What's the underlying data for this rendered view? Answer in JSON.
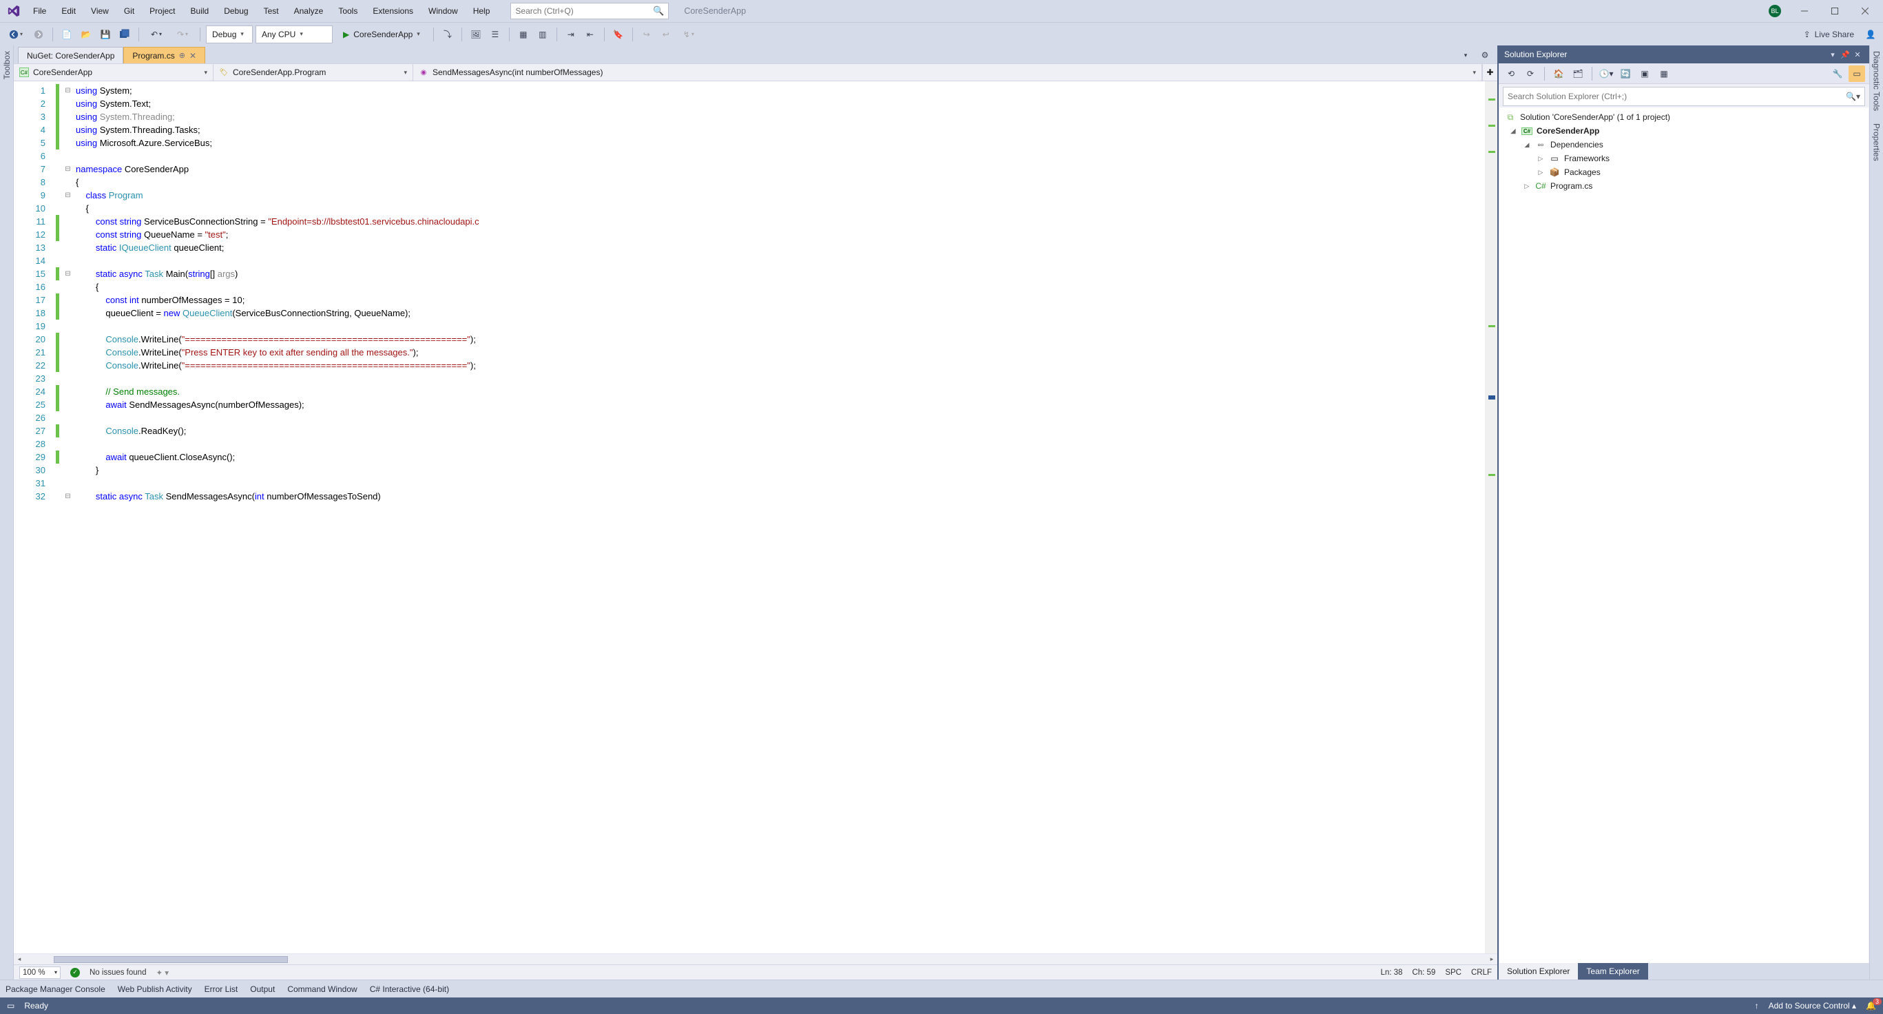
{
  "titlebar": {
    "menus": [
      "File",
      "Edit",
      "View",
      "Git",
      "Project",
      "Build",
      "Debug",
      "Test",
      "Analyze",
      "Tools",
      "Extensions",
      "Window",
      "Help"
    ],
    "searchPlaceholder": "Search (Ctrl+Q)",
    "appName": "CoreSenderApp",
    "avatar": "BL"
  },
  "toolbar": {
    "configCombo": "Debug",
    "platformCombo": "Any CPU",
    "startTarget": "CoreSenderApp",
    "liveShare": "Live Share"
  },
  "leftPanel": {
    "label": "Toolbox"
  },
  "rightPanel": {
    "labels": [
      "Diagnostic Tools",
      "Properties"
    ]
  },
  "docTabs": {
    "tabs": [
      {
        "label": "NuGet: CoreSenderApp",
        "active": false
      },
      {
        "label": "Program.cs",
        "active": true
      }
    ]
  },
  "navbar": {
    "scope": "CoreSenderApp",
    "type": "CoreSenderApp.Program",
    "member": "SendMessagesAsync(int numberOfMessages)"
  },
  "code": {
    "lines": [
      {
        "n": 1,
        "chg": true,
        "fold": "-",
        "tokens": [
          [
            "kw",
            "using"
          ],
          [
            "ident",
            " System;"
          ]
        ]
      },
      {
        "n": 2,
        "chg": true,
        "tokens": [
          [
            "kw",
            "using"
          ],
          [
            "ident",
            " System.Text;"
          ]
        ]
      },
      {
        "n": 3,
        "chg": true,
        "tokens": [
          [
            "kw",
            "using"
          ],
          [
            "fade",
            " System.Threading;"
          ]
        ]
      },
      {
        "n": 4,
        "chg": true,
        "tokens": [
          [
            "kw",
            "using"
          ],
          [
            "ident",
            " System.Threading.Tasks;"
          ]
        ]
      },
      {
        "n": 5,
        "chg": true,
        "tokens": [
          [
            "kw",
            "using"
          ],
          [
            "ident",
            " Microsoft.Azure.ServiceBus;"
          ]
        ]
      },
      {
        "n": 6,
        "tokens": []
      },
      {
        "n": 7,
        "fold": "-",
        "tokens": [
          [
            "kw",
            "namespace"
          ],
          [
            "ident",
            " CoreSenderApp"
          ]
        ]
      },
      {
        "n": 8,
        "tokens": [
          [
            "ident",
            "{"
          ]
        ]
      },
      {
        "n": 9,
        "fold": "-",
        "tokens": [
          [
            "ident",
            "    "
          ],
          [
            "kw",
            "class"
          ],
          [
            "ident",
            " "
          ],
          [
            "type",
            "Program"
          ]
        ]
      },
      {
        "n": 10,
        "tokens": [
          [
            "ident",
            "    {"
          ]
        ]
      },
      {
        "n": 11,
        "chg": true,
        "tokens": [
          [
            "ident",
            "        "
          ],
          [
            "kw",
            "const"
          ],
          [
            "ident",
            " "
          ],
          [
            "kw",
            "string"
          ],
          [
            "ident",
            " ServiceBusConnectionString = "
          ],
          [
            "str",
            "\"Endpoint=sb://lbsbtest01.servicebus.chinacloudapi.c"
          ]
        ]
      },
      {
        "n": 12,
        "chg": true,
        "tokens": [
          [
            "ident",
            "        "
          ],
          [
            "kw",
            "const"
          ],
          [
            "ident",
            " "
          ],
          [
            "kw",
            "string"
          ],
          [
            "ident",
            " QueueName = "
          ],
          [
            "str",
            "\"test\""
          ],
          [
            "ident",
            ";"
          ]
        ]
      },
      {
        "n": 13,
        "tokens": [
          [
            "ident",
            "        "
          ],
          [
            "kw",
            "static"
          ],
          [
            "ident",
            " "
          ],
          [
            "type",
            "IQueueClient"
          ],
          [
            "ident",
            " queueClient;"
          ]
        ]
      },
      {
        "n": 14,
        "tokens": []
      },
      {
        "n": 15,
        "chg": true,
        "fold": "-",
        "tokens": [
          [
            "ident",
            "        "
          ],
          [
            "kw",
            "static"
          ],
          [
            "ident",
            " "
          ],
          [
            "kw",
            "async"
          ],
          [
            "ident",
            " "
          ],
          [
            "type",
            "Task"
          ],
          [
            "ident",
            " Main("
          ],
          [
            "kw",
            "string"
          ],
          [
            "ident",
            "[] "
          ],
          [
            "fade",
            "args"
          ],
          [
            "ident",
            ")"
          ]
        ]
      },
      {
        "n": 16,
        "tokens": [
          [
            "ident",
            "        {"
          ]
        ]
      },
      {
        "n": 17,
        "chg": true,
        "tokens": [
          [
            "ident",
            "            "
          ],
          [
            "kw",
            "const"
          ],
          [
            "ident",
            " "
          ],
          [
            "kw",
            "int"
          ],
          [
            "ident",
            " numberOfMessages = 10;"
          ]
        ]
      },
      {
        "n": 18,
        "chg": true,
        "tokens": [
          [
            "ident",
            "            queueClient = "
          ],
          [
            "kw",
            "new"
          ],
          [
            "ident",
            " "
          ],
          [
            "type",
            "QueueClient"
          ],
          [
            "ident",
            "(ServiceBusConnectionString, QueueName);"
          ]
        ]
      },
      {
        "n": 19,
        "tokens": []
      },
      {
        "n": 20,
        "chg": true,
        "tokens": [
          [
            "ident",
            "            "
          ],
          [
            "type",
            "Console"
          ],
          [
            "ident",
            ".WriteLine("
          ],
          [
            "str",
            "\"======================================================\""
          ],
          [
            "ident",
            ");"
          ]
        ]
      },
      {
        "n": 21,
        "chg": true,
        "tokens": [
          [
            "ident",
            "            "
          ],
          [
            "type",
            "Console"
          ],
          [
            "ident",
            ".WriteLine("
          ],
          [
            "str",
            "\"Press ENTER key to exit after sending all the messages.\""
          ],
          [
            "ident",
            ");"
          ]
        ]
      },
      {
        "n": 22,
        "chg": true,
        "tokens": [
          [
            "ident",
            "            "
          ],
          [
            "type",
            "Console"
          ],
          [
            "ident",
            ".WriteLine("
          ],
          [
            "str",
            "\"======================================================\""
          ],
          [
            "ident",
            ");"
          ]
        ]
      },
      {
        "n": 23,
        "tokens": []
      },
      {
        "n": 24,
        "chg": true,
        "tokens": [
          [
            "ident",
            "            "
          ],
          [
            "comment",
            "// Send messages."
          ]
        ]
      },
      {
        "n": 25,
        "chg": true,
        "tokens": [
          [
            "ident",
            "            "
          ],
          [
            "kw",
            "await"
          ],
          [
            "ident",
            " SendMessagesAsync(numberOfMessages);"
          ]
        ]
      },
      {
        "n": 26,
        "tokens": []
      },
      {
        "n": 27,
        "chg": true,
        "tokens": [
          [
            "ident",
            "            "
          ],
          [
            "type",
            "Console"
          ],
          [
            "ident",
            ".ReadKey();"
          ]
        ]
      },
      {
        "n": 28,
        "tokens": []
      },
      {
        "n": 29,
        "chg": true,
        "tokens": [
          [
            "ident",
            "            "
          ],
          [
            "kw",
            "await"
          ],
          [
            "ident",
            " queueClient.CloseAsync();"
          ]
        ]
      },
      {
        "n": 30,
        "tokens": [
          [
            "ident",
            "        }"
          ]
        ]
      },
      {
        "n": 31,
        "tokens": []
      },
      {
        "n": 32,
        "fold": "-",
        "tokens": [
          [
            "ident",
            "        "
          ],
          [
            "kw",
            "static"
          ],
          [
            "ident",
            " "
          ],
          [
            "kw",
            "async"
          ],
          [
            "ident",
            " "
          ],
          [
            "type",
            "Task"
          ],
          [
            "ident",
            " SendMessagesAsync("
          ],
          [
            "kw",
            "int"
          ],
          [
            "ident",
            " numberOfMessagesToSend)"
          ]
        ]
      }
    ]
  },
  "editStatus": {
    "zoom": "100 %",
    "issues": "No issues found",
    "ln": "Ln: 38",
    "ch": "Ch: 59",
    "ins": "SPC",
    "eol": "CRLF"
  },
  "solutionExplorer": {
    "title": "Solution Explorer",
    "searchPlaceholder": "Search Solution Explorer (Ctrl+;)",
    "solutionLine": "Solution 'CoreSenderApp' (1 of 1 project)",
    "project": "CoreSenderApp",
    "nodes": {
      "dependencies": "Dependencies",
      "frameworks": "Frameworks",
      "packages": "Packages",
      "program": "Program.cs"
    },
    "bottomTabs": {
      "a": "Solution Explorer",
      "b": "Team Explorer"
    }
  },
  "bottomTabs": [
    "Package Manager Console",
    "Web Publish Activity",
    "Error List",
    "Output",
    "Command Window",
    "C# Interactive (64-bit)"
  ],
  "statusBar": {
    "ready": "Ready",
    "sourceControl": "Add to Source Control",
    "notifications": "3"
  }
}
